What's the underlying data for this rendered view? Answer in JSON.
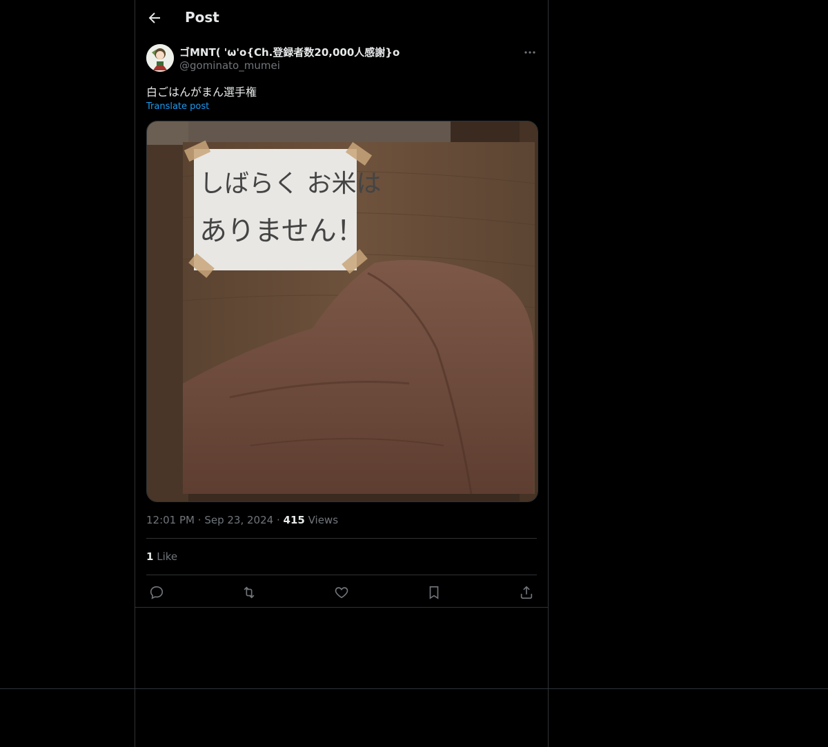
{
  "header": {
    "title": "Post"
  },
  "post": {
    "author_name": "ゴMNT( 'ω'o{Ch.登録者数20,000人感謝}o",
    "author_handle": "@gominato_mumei",
    "text": "白ごはんがまん選手権",
    "translate_label": "Translate post",
    "media": {
      "sign_line1": "しばらく お米は",
      "sign_line2": "ありません！"
    },
    "time": "12:01 PM",
    "date": "Sep 23, 2024",
    "separator": "·",
    "views_count": "415",
    "views_label": "Views",
    "likes_count": "1",
    "likes_label": "Like"
  },
  "icons": {
    "back": "arrow-left-icon",
    "more": "more-horizontal-icon",
    "reply": "reply-icon",
    "repost": "repost-icon",
    "like": "heart-icon",
    "bookmark": "bookmark-icon",
    "share": "share-icon"
  },
  "colors": {
    "background": "#000000",
    "border": "#2f3336",
    "text_primary": "#e7e9ea",
    "text_secondary": "#71767b",
    "link": "#1d9bf0"
  }
}
